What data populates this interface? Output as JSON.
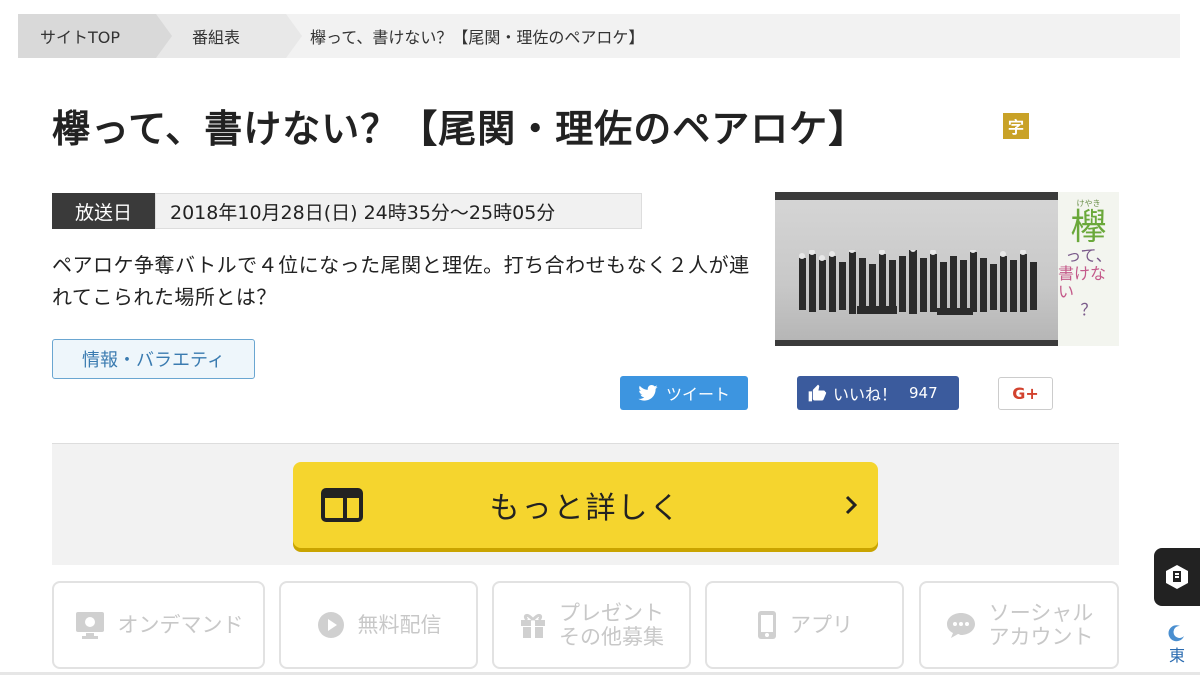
{
  "breadcrumb": {
    "items": [
      {
        "label": "サイトTOP"
      },
      {
        "label": "番組表"
      },
      {
        "label": "欅って、書けない？【尾関・理佐のペアロケ】"
      }
    ]
  },
  "program": {
    "title": "欅って、書けない？【尾関・理佐のペアロケ】",
    "subtitle_badge": "字",
    "broadcast_label": "放送日",
    "broadcast_value": "2018年10月28日(日) 24時35分～25時05分",
    "description": "ペアロケ争奪バトルで４位になった尾関と理佐。打ち合わせもなく２人が連れてこられた場所とは？",
    "genre": "情報・バラエティ"
  },
  "thumbnail": {
    "logo_ruby": "けやき",
    "logo_big": "欅",
    "logo_line1": "って、",
    "logo_line2": "書けない",
    "logo_line3": "？"
  },
  "social": {
    "tweet_label": "ツイート",
    "like_label": "いいね！",
    "like_count": "947",
    "gplus_label": "G+"
  },
  "more": {
    "label": "もっと詳しく"
  },
  "tiles": [
    {
      "label": "オンデマンド",
      "icon": "monitor-icon"
    },
    {
      "label": "無料配信",
      "icon": "replay-icon"
    },
    {
      "label": "プレゼント\nその他募集",
      "icon": "gift-icon"
    },
    {
      "label": "アプリ",
      "icon": "phone-icon"
    },
    {
      "label": "ソーシャル\nアカウント",
      "icon": "chat-bubble-icon"
    }
  ],
  "side": {
    "tab_icon": "book-icon",
    "moon_icon": "moon-icon",
    "partial_text": "東"
  },
  "colors": {
    "accent_yellow": "#f5d52e",
    "tweet_blue": "#3d95e0",
    "facebook_blue": "#3b5b9d",
    "gplus_red": "#d2422e",
    "badge_gold": "#c9a227",
    "genre_blue": "#3a7bb0"
  }
}
